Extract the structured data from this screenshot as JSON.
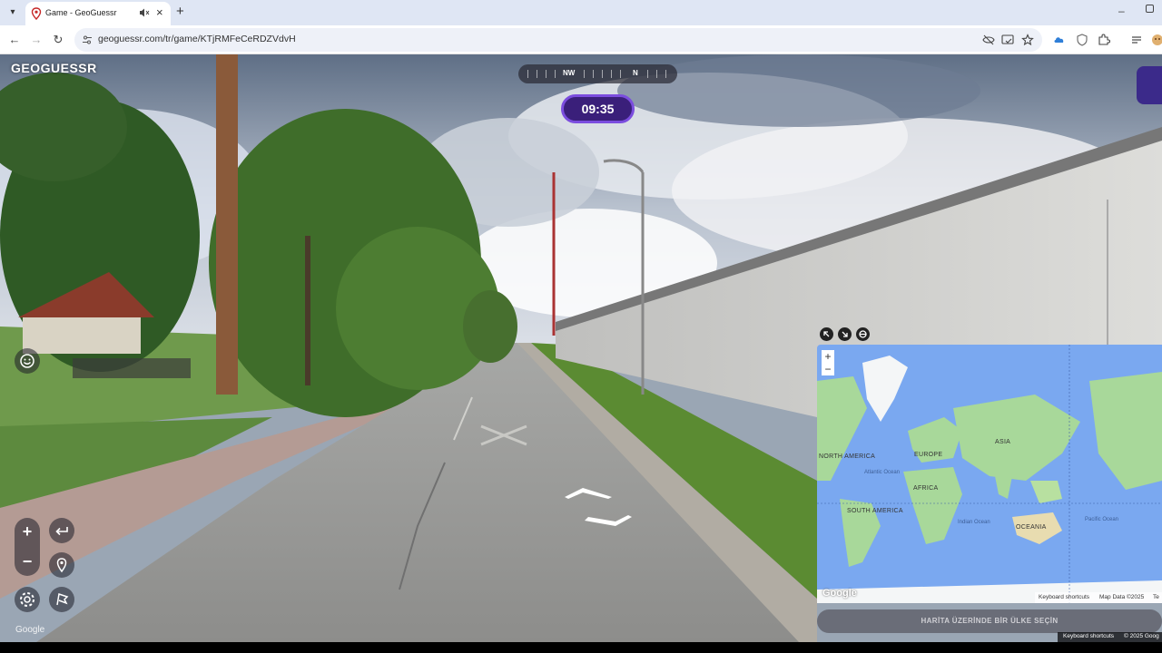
{
  "browser": {
    "tab_title": "Game - GeoGuessr",
    "url": "geoguessr.com/tr/game/KTjRMFeCeRDZVdvH",
    "new_tab": "+",
    "close_tab": "×",
    "minimize": "–"
  },
  "game": {
    "logo": "GEOGUESSR",
    "compass_labels": [
      "NW",
      "N"
    ],
    "timer": "09:35",
    "street_view_watermark": "Google",
    "controls": {
      "zoom_in": "+",
      "zoom_out": "−"
    }
  },
  "map": {
    "zoom_in": "+",
    "zoom_out": "−",
    "continents": [
      "ASIA",
      "EUROPE",
      "AFRICA",
      "SOUTH AMERICA",
      "OCEANIA",
      "NORTH AMERICA"
    ],
    "oceans": [
      "Atlantic Ocean",
      "Indian Ocean",
      "Pacific Ocean"
    ],
    "google": "Google",
    "footer": {
      "shortcuts": "Keyboard shortcuts",
      "map_data": "Map Data ©2025",
      "terms": "Te"
    },
    "guess_button": "HARİTA ÜZERİNDE BİR ÜLKE SEÇİN"
  },
  "street_view_footer": {
    "shortcuts": "Keyboard shortcuts",
    "copyright": "© 2025 Goog"
  },
  "colors": {
    "timer_border": "#7b4dde",
    "timer_bg": "#3a1f7a",
    "ocean": "#7aa8f0",
    "land": "#a8d89a"
  }
}
